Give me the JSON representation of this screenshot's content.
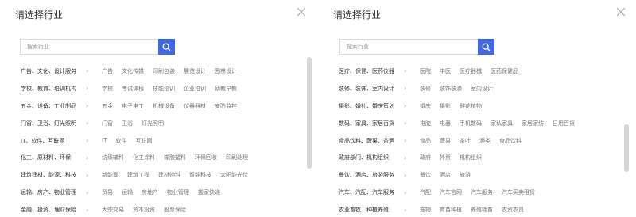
{
  "left": {
    "title": "请选择行业",
    "search_placeholder": "搜索行业",
    "rows": [
      {
        "category": "广告、文化、设计服务",
        "subs": [
          "广告",
          "文化传媒",
          "印刷包装",
          "展览设计",
          "园林设计"
        ]
      },
      {
        "category": "学校、教育、培训机构",
        "subs": [
          "学校",
          "考试课程",
          "技能培训",
          "企业培训",
          "幼教早教"
        ]
      },
      {
        "category": "五金、设备、工业制品",
        "subs": [
          "五金",
          "电子电工",
          "机械设备",
          "仪器器材",
          "安防监控"
        ]
      },
      {
        "category": "门窗、卫浴、灯光照明",
        "subs": [
          "门窗",
          "卫浴",
          "灯光照明"
        ]
      },
      {
        "category": "IT、软件、互联网",
        "subs": [
          "IT",
          "软件",
          "互联网"
        ]
      },
      {
        "category": "化工、原材料、环保",
        "subs": [
          "纺织辅料",
          "化工涂料",
          "橡胶塑料",
          "环保回收",
          "印刷处理"
        ]
      },
      {
        "category": "建筑建材、能源、科技",
        "subs": [
          "新能源",
          "建筑工程",
          "建材物料",
          "智能科技",
          "太阳能光伏"
        ]
      },
      {
        "category": "运输、房产、物业管理",
        "subs": [
          "贸易",
          "运输",
          "房地产",
          "物业管理",
          "搬家快递"
        ]
      },
      {
        "category": "金融、投资、理财保险",
        "subs": [
          "大宗交易",
          "资本投资",
          "股票保险"
        ]
      }
    ]
  },
  "right": {
    "title": "请选择行业",
    "search_placeholder": "搜索行业",
    "rows": [
      {
        "category": "医疗、保健、医药仪器",
        "subs": [
          "医院",
          "中医",
          "医疗器械",
          "医药保健品"
        ]
      },
      {
        "category": "装修、装饰、室内设计",
        "subs": [
          "装修",
          "装饰装潢",
          "室内设计"
        ]
      },
      {
        "category": "摄影、婚礼、婚庆策划",
        "subs": [
          "婚庆",
          "摄影",
          "鲜花植物"
        ]
      },
      {
        "category": "数码、家具、家居百货",
        "subs": [
          "电脑",
          "电器",
          "手机数码",
          "家私家具",
          "家居家纺",
          "日用百货"
        ]
      },
      {
        "category": "食品饮料、蔬果、茶酒",
        "subs": [
          "食品",
          "蔬果",
          "茶叶",
          "酒类",
          "食品饮料"
        ]
      },
      {
        "category": "政府部门、机构组织",
        "subs": [
          "政府",
          "外贸",
          "机构组织"
        ]
      },
      {
        "category": "餐饮、酒店、旅游服务",
        "subs": [
          "餐饮",
          "酒店",
          "旅游"
        ]
      },
      {
        "category": "汽车、汽配、汽车服务",
        "subs": [
          "汽配",
          "汽车官网",
          "汽车服务",
          "汽车买卖租赁"
        ]
      },
      {
        "category": "农业畜牧、种植养殖",
        "subs": [
          "宠物",
          "育苗种植",
          "养殖牲畜",
          "农资农具"
        ]
      }
    ]
  },
  "icons": {
    "close": "close-icon",
    "search": "search-icon",
    "chevron": "chevron-right-icon"
  },
  "chevron_glyph": "›",
  "colors": {
    "accent": "#4169e1",
    "text": "#333333",
    "muted": "#777777",
    "border": "#dcdcdc",
    "scrollbar": "#d6d6d6"
  },
  "scroll": {
    "left_fraction_visible": 0.7,
    "left_position": 0.0,
    "right_fraction_visible": 0.3,
    "right_position": 0.6
  }
}
